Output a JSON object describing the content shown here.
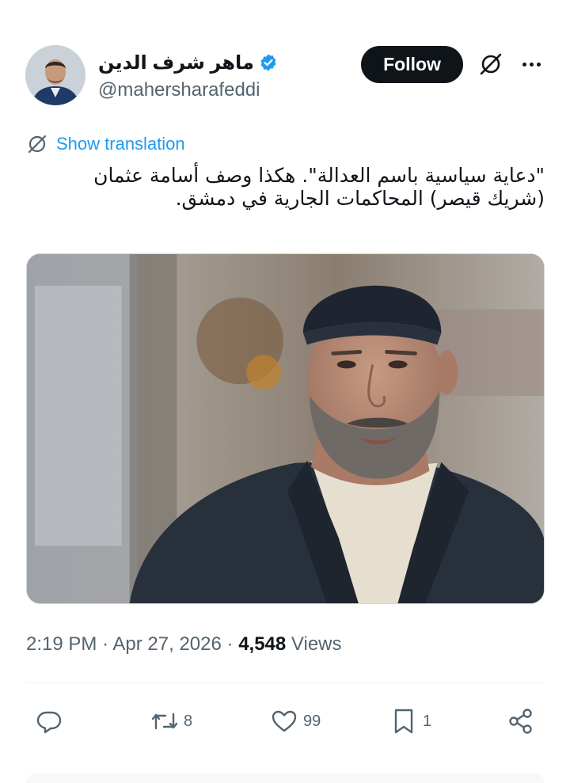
{
  "author": {
    "display_name": "ماهر شرف الدين",
    "handle": "@mahersharafeddi",
    "verified_icon": "verified-badge-icon",
    "verified_color": "#1d9bf0"
  },
  "header": {
    "follow_label": "Follow",
    "grok_icon": "grok-icon",
    "more_icon": "more-options-icon"
  },
  "translation": {
    "label": "Show translation",
    "icon": "globe-icon",
    "color": "#1d9bf0"
  },
  "tweet": {
    "lines": [
      "\"دعاية سياسية باسم العدالة\". هكذا وصف أسامة عثمان",
      "(شريك قيصر) المحاكمات الجارية في دمشق."
    ]
  },
  "meta": {
    "time": "2:19 PM",
    "date": "Apr 27, 2026",
    "views_count": "4,548",
    "views_label": "Views",
    "separator": "·"
  },
  "actions": {
    "reply": {
      "icon": "reply-icon",
      "count": ""
    },
    "retweet": {
      "icon": "retweet-icon",
      "count": "8"
    },
    "like": {
      "icon": "heart-icon",
      "count": "99"
    },
    "bookmark": {
      "icon": "bookmark-icon",
      "count": "1"
    },
    "share": {
      "icon": "share-icon",
      "count": ""
    }
  }
}
